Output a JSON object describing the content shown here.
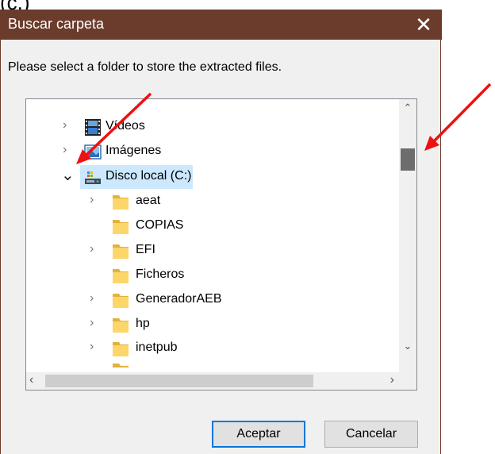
{
  "corner_label": "(c.)",
  "dialog": {
    "title": "Buscar carpeta",
    "close_glyph": "✕",
    "instruction": "Please select a folder to store the extracted files.",
    "ok_label": "Aceptar",
    "cancel_label": "Cancelar"
  },
  "tree": {
    "items": [
      {
        "label": "Vídeos",
        "icon": "videos-icon",
        "expander": "collapsed"
      },
      {
        "label": "Imágenes",
        "icon": "pictures-icon",
        "expander": "collapsed"
      },
      {
        "label": "Disco local (C:)",
        "icon": "drive-icon",
        "expander": "expanded",
        "selected": true
      },
      {
        "label": "aeat",
        "icon": "folder-icon",
        "expander": "collapsed"
      },
      {
        "label": "COPIAS",
        "icon": "folder-icon",
        "expander": "none"
      },
      {
        "label": "EFI",
        "icon": "folder-icon",
        "expander": "collapsed"
      },
      {
        "label": "Ficheros",
        "icon": "folder-icon",
        "expander": "none"
      },
      {
        "label": "GeneradorAEB",
        "icon": "folder-icon",
        "expander": "collapsed"
      },
      {
        "label": "hp",
        "icon": "folder-icon",
        "expander": "collapsed"
      },
      {
        "label": "inetpub",
        "icon": "folder-icon",
        "expander": "collapsed"
      }
    ]
  },
  "glyphs": {
    "chevron_right": "›",
    "chevron_down": "⌄",
    "up": "⌃",
    "down": "⌄",
    "left": "‹",
    "right": "›"
  },
  "annotations": {
    "arrow_color": "#ee1111",
    "arrows": [
      "arrow-to-expand-chevron",
      "arrow-to-scrollbar-thumb"
    ]
  }
}
